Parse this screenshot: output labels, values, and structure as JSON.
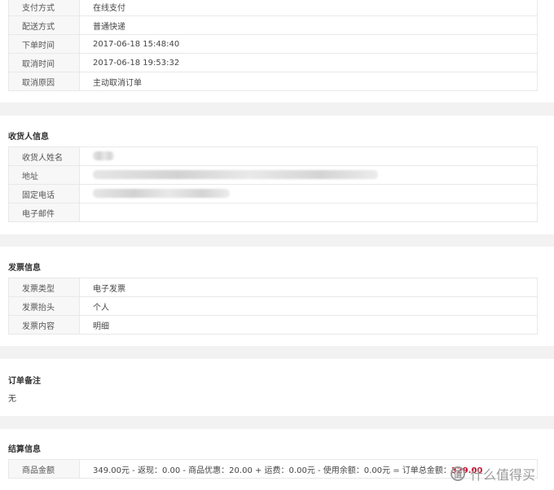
{
  "order_info": {
    "rows": [
      {
        "label": "支付方式",
        "value": "在线支付"
      },
      {
        "label": "配送方式",
        "value": "普通快递"
      },
      {
        "label": "下单时间",
        "value": "2017-06-18 15:48:40"
      },
      {
        "label": "取消时间",
        "value": "2017-06-18 19:53:32"
      },
      {
        "label": "取消原因",
        "value": "主动取消订单"
      }
    ]
  },
  "consignee": {
    "title": "收货人信息",
    "rows": [
      {
        "label": "收货人姓名"
      },
      {
        "label": "地址"
      },
      {
        "label": "固定电话"
      },
      {
        "label": "电子邮件"
      }
    ]
  },
  "invoice": {
    "title": "发票信息",
    "rows": [
      {
        "label": "发票类型",
        "value": "电子发票"
      },
      {
        "label": "发票抬头",
        "value": "个人"
      },
      {
        "label": "发票内容",
        "value": "明细"
      }
    ]
  },
  "remark": {
    "title": "订单备注",
    "value": "无"
  },
  "settlement": {
    "title": "结算信息",
    "label": "商品金额",
    "formula": "349.00元 - 返现：0.00 - 商品优惠：20.00 + 运费：0.00元 - 使用余额：0.00元 = 订单总金额：",
    "total": "329.00"
  },
  "watermark": {
    "badge": "值",
    "text": "什么值得买"
  },
  "colors": {
    "accent": "#c8102e",
    "background": "#f2f2f2"
  }
}
